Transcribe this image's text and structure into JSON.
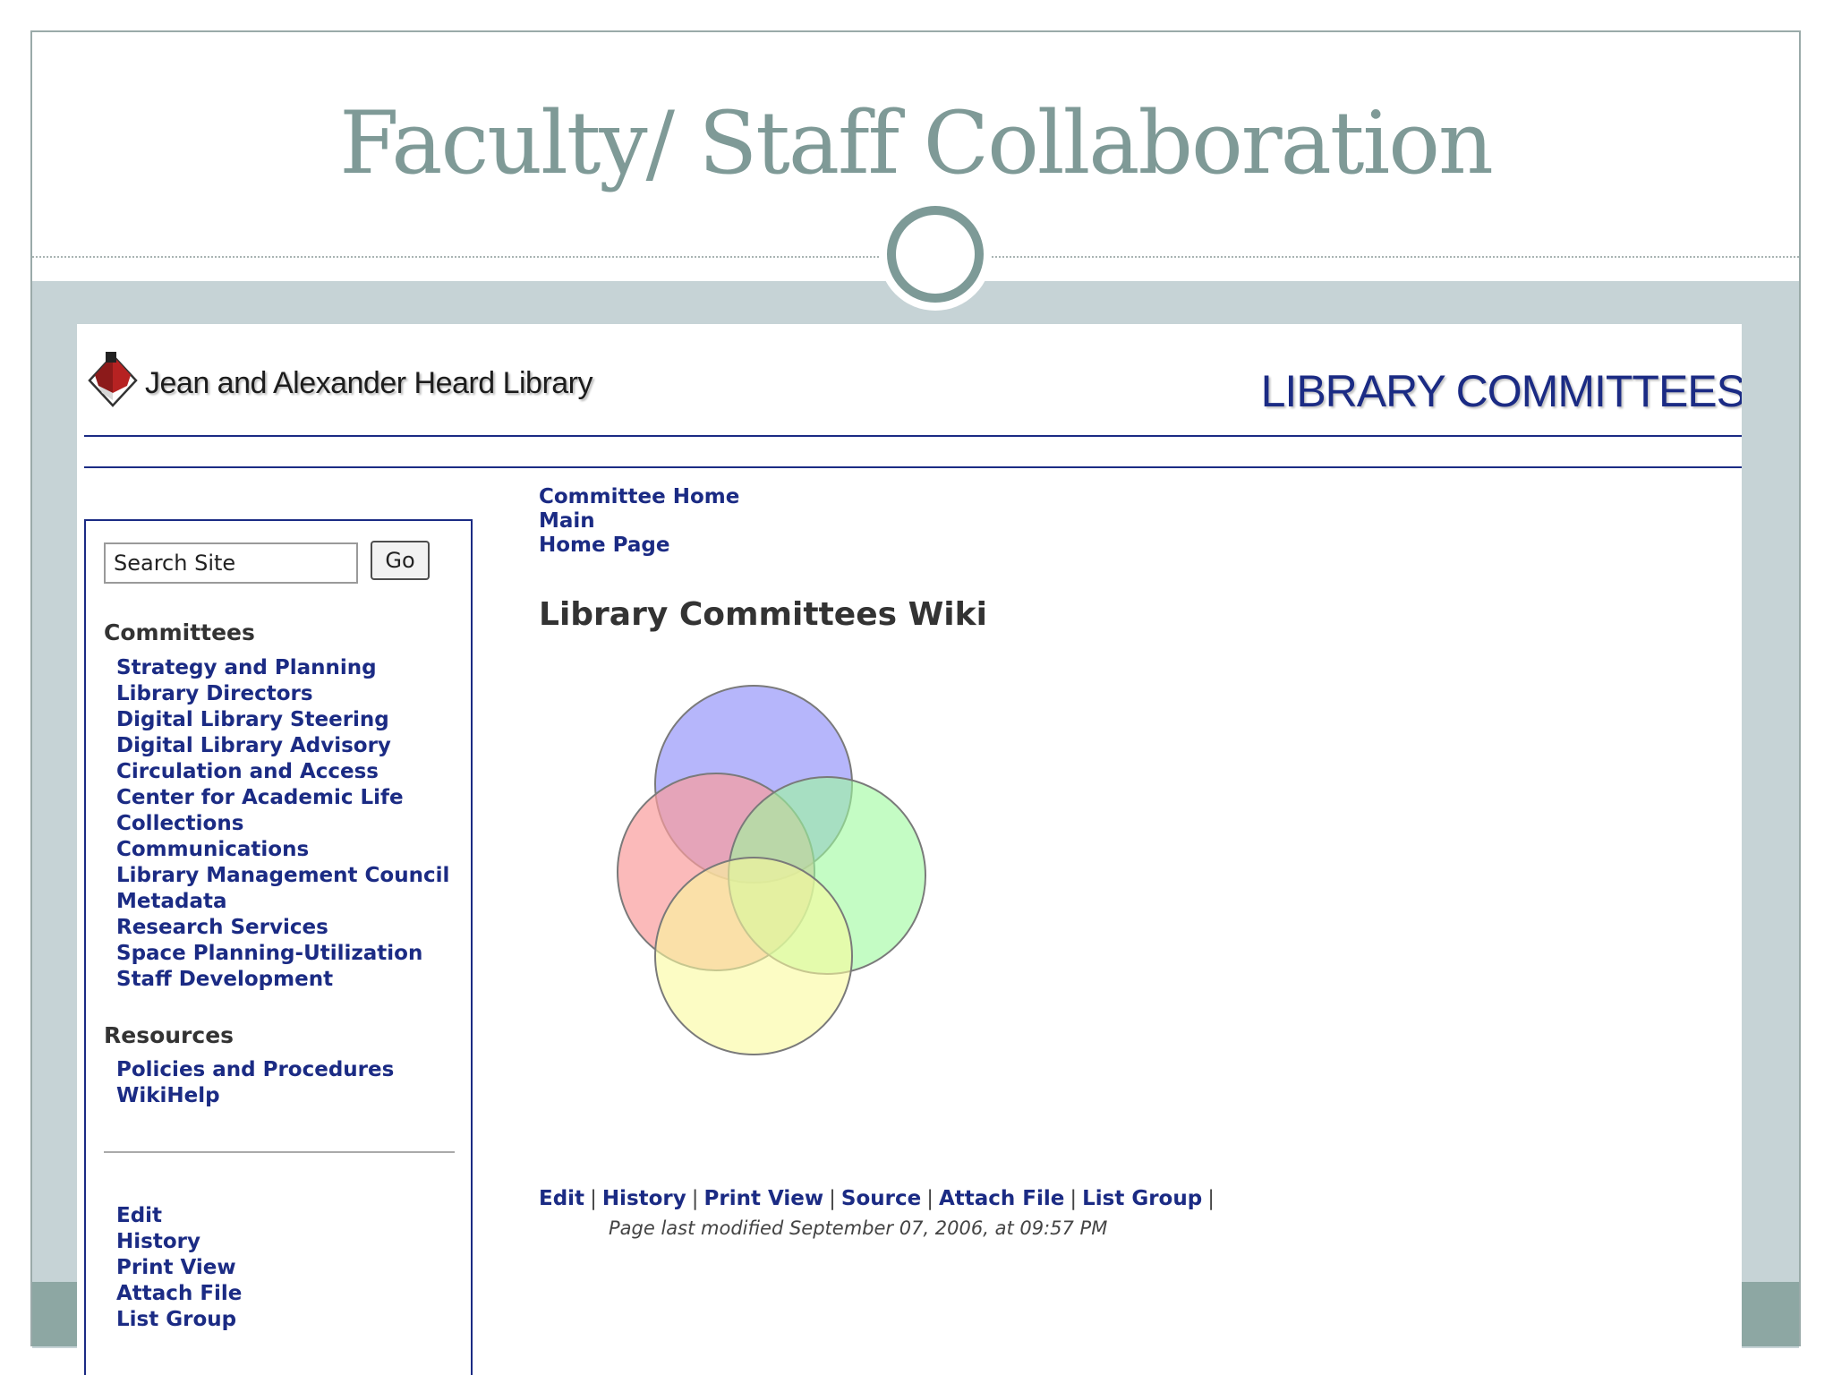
{
  "slide": {
    "title": "Faculty/ Staff Collaboration"
  },
  "header": {
    "library_name": "Jean and Alexander Heard Library",
    "banner": "LIBRARY COMMITTEES"
  },
  "search": {
    "placeholder": "Search Site",
    "go_label": "Go"
  },
  "sidebar": {
    "committees_heading": "Committees",
    "committees": [
      "Strategy and Planning",
      "Library Directors",
      "Digital Library Steering",
      "Digital Library Advisory",
      "Circulation and Access",
      "Center for Academic Life",
      "Collections",
      "Communications",
      "Library Management Council",
      "Metadata",
      "Research Services",
      "Space Planning-Utilization",
      "Staff Development"
    ],
    "resources_heading": "Resources",
    "resources": [
      "Policies and Procedures",
      "WikiHelp"
    ],
    "actions": [
      "Edit",
      "History",
      "Print View",
      "Attach File",
      "List Group"
    ]
  },
  "breadcrumb": [
    "Committee Home",
    "Main",
    "Home Page"
  ],
  "page": {
    "heading": "Library Committees Wiki",
    "actions": [
      "Edit",
      "History",
      "Print View",
      "Source",
      "Attach File",
      "List Group"
    ],
    "last_modified": "Page last modified September 07, 2006, at 09:57 PM"
  },
  "colors": {
    "slide_title": "#7f9a97",
    "link": "#1b2b84",
    "frame_band": "#c6d3d6",
    "venn_top": "#9d9dfa",
    "venn_left": "#fa9d9d",
    "venn_right": "#9dfa9d",
    "venn_bottom": "#fafa9d"
  },
  "icons": {
    "logo": "heard-library-logo-icon"
  }
}
